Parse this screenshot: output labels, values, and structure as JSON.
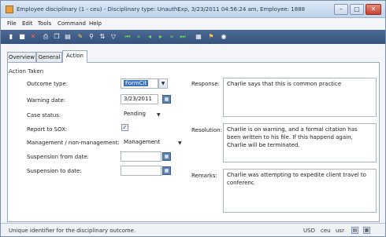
{
  "window": {
    "title": "Employee disciplinary (1 - ceu) - Disciplinary type: UnauthExp, 3/23/2011 04:56:24 am, Employee: 1888",
    "controls": [
      "–",
      "□",
      "✕"
    ]
  },
  "menu": [
    "File",
    "Edit",
    "Tools",
    "Command",
    "Help"
  ],
  "toolbar_icons": [
    "new-icon",
    "save-icon",
    "delete-icon",
    "print-icon",
    "copy-icon",
    "paste-icon",
    "filter-icon",
    "filter-selection-icon",
    "sort-icon",
    "advanced-filter-icon",
    "first-record-icon",
    "previous-page-icon",
    "previous-record-icon",
    "next-record-icon",
    "next-page-icon",
    "last-record-icon",
    "document-icon",
    "attach-icon",
    "help-icon"
  ],
  "tabs": [
    "Overview",
    "General",
    "Action"
  ],
  "active_tab": "Action",
  "group_title": "Action Taken",
  "form": {
    "outcome_type": {
      "label": "Outcome type:",
      "value": "FormCit"
    },
    "warning_date": {
      "label": "Warning date:",
      "value": "3/23/2011"
    },
    "case_status": {
      "label": "Case status:",
      "value": "Pending"
    },
    "report_to_sox": {
      "label": "Report to SOX:",
      "checked": true
    },
    "management": {
      "label": "Management / non-management:",
      "value": "Management"
    },
    "suspension_from": {
      "label": "Suspension from date:",
      "value": ""
    },
    "suspension_to": {
      "label": "Suspension to date:",
      "value": ""
    }
  },
  "right": {
    "response": {
      "label": "Response:",
      "value": "Charlie says that this is common practice"
    },
    "resolution": {
      "label": "Resolution:",
      "value": "Charlie is on warning, and a formal citation has been written to his file. If this happend again, Charlie will be terminated."
    },
    "remarks": {
      "label": "Remarks:",
      "value": "Charlie was attempting to expedite client travel to conferenc"
    }
  },
  "status": {
    "hint": "Unique identifier for the disciplinary outcome.",
    "currency": "USD",
    "company": "ceu",
    "user": "usr"
  }
}
